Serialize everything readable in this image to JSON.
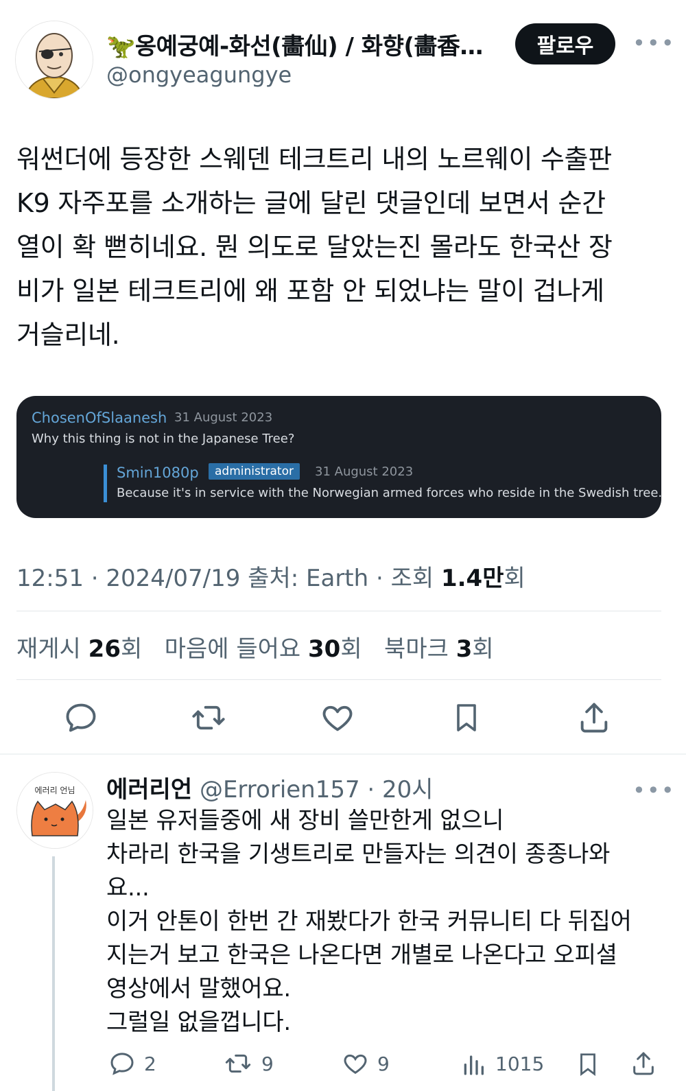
{
  "tweet": {
    "author": {
      "display_name": "🦖옹예궁예-화선(畵仙) / 화향(畵香…",
      "handle": "@ongyeagungye"
    },
    "follow_label": "팔로우",
    "text_lines": [
      "워썬더에 등장한 스웨덴 테크트리 내의 노르웨이 수출판",
      "K9 자주포를 소개하는 글에 달린 댓글인데 보면서 순간",
      "열이 확 뻗히네요. 뭔 의도로 달았는진 몰라도 한국산 장",
      "비가 일본 테크트리에 왜 포함 안 되었냐는 말이 겁나게",
      "거슬리네."
    ],
    "embed": {
      "comment_user": "ChosenOfSlaanesh",
      "comment_date": "31 August 2023",
      "comment_text": "Why this thing is not in the Japanese Tree?",
      "reply_user": "Smin1080p",
      "reply_badge": "administrator",
      "reply_date": "31 August 2023",
      "reply_text": "Because it's in service with the Norwegian armed forces who reside in the Swedish tree."
    },
    "meta": {
      "time_date_source": "12:51 · 2024/07/19 출처: Earth · 조회 ",
      "views_number": "1.4만",
      "views_suffix": "회"
    },
    "stats": {
      "retweets_label": "재게시 ",
      "retweets_value": "26",
      "retweets_suffix": "회",
      "likes_label": "마음에 들어요 ",
      "likes_value": "30",
      "likes_suffix": "회",
      "bookmarks_label": "북마크 ",
      "bookmarks_value": "3",
      "bookmarks_suffix": "회"
    }
  },
  "reply": {
    "display_name": "에러리언",
    "handle_time": "@Errorien157 · 20시",
    "avatar_caption": "에러리 언님",
    "text_lines": [
      "일본 유저들중에 새 장비 쓸만한게 없으니",
      "차라리 한국을 기생트리로 만들자는 의견이 종종나와",
      "요...",
      "이거 안톤이 한번 간 재봤다가 한국 커뮤니티 다 뒤집어",
      "지는거 보고 한국은 나온다면 개별로 나온다고 오피셜",
      "영상에서 말했어요.",
      "그럴일 없을껍니다."
    ],
    "counts": {
      "replies": "2",
      "retweets": "9",
      "likes": "9",
      "views": "1015"
    }
  },
  "icons": {
    "reply": "reply-icon",
    "retweet": "retweet-icon",
    "like": "heart-icon",
    "bookmark": "bookmark-icon",
    "share": "share-icon",
    "views": "views-icon",
    "more": "more-icon"
  },
  "colors": {
    "text": "#0f1419",
    "secondary": "#536471",
    "follow_button": "#0f1419",
    "embed_bg": "#1b1f26",
    "embed_link": "#64a6d8"
  }
}
